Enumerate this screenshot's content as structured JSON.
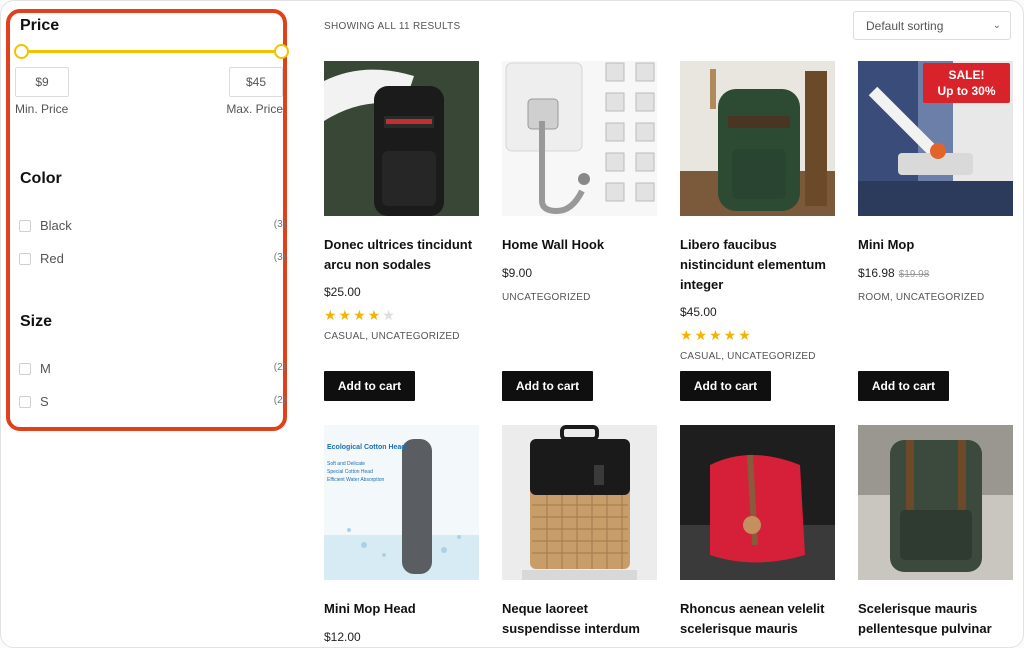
{
  "sidebar": {
    "price": {
      "title": "Price",
      "min_value": "$9",
      "max_value": "$45",
      "min_label": "Min. Price",
      "max_label": "Max. Price"
    },
    "color": {
      "title": "Color",
      "options": [
        {
          "label": "Black",
          "count": "(3)"
        },
        {
          "label": "Red",
          "count": "(3)"
        }
      ]
    },
    "size": {
      "title": "Size",
      "options": [
        {
          "label": "M",
          "count": "(2)"
        },
        {
          "label": "S",
          "count": "(2)"
        }
      ]
    }
  },
  "toolbar": {
    "results": "SHOWING ALL 11 RESULTS",
    "sort_selected": "Default sorting"
  },
  "products": [
    {
      "name": "Donec ultrices tincidunt arcu non sodales",
      "price": "$25.00",
      "rating": 4,
      "categories": "CASUAL, UNCATEGORIZED",
      "button": "Add to cart",
      "image": "black-backpack"
    },
    {
      "name": "Home Wall Hook",
      "price": "$9.00",
      "categories": "UNCATEGORIZED",
      "button": "Add to cart",
      "image": "wall-hook"
    },
    {
      "name": "Libero faucibus nistincidunt elementum integer",
      "price": "$45.00",
      "rating": 5,
      "categories": "CASUAL, UNCATEGORIZED",
      "button": "Add to cart",
      "image": "green-backpack"
    },
    {
      "name": "Mini Mop",
      "price": "$16.98",
      "old_price": "$19.98",
      "categories": "ROOM, UNCATEGORIZED",
      "button": "Add to cart",
      "image": "mini-mop",
      "badge_line1": "SALE!",
      "badge_line2": "Up to 30%"
    },
    {
      "name": "Mini Mop Head",
      "price": "$12.00",
      "image": "mop-head",
      "image_text": [
        "Ecological Cotton Head",
        "Soft and Delicate",
        "Special Cotton Head",
        "Efficient Water Absorption"
      ]
    },
    {
      "name": "Neque laoreet suspendisse interdum consectetur",
      "image": "woven-bag"
    },
    {
      "name": "Rhoncus aenean velelit scelerisque mauris",
      "image": "red-backpack"
    },
    {
      "name": "Scelerisque mauris pellentesque pulvinar",
      "image": "canvas-backpack"
    }
  ],
  "colors": {
    "accent_slider": "#f2c200",
    "sidebar_highlight": "#e0401a",
    "sale_badge": "#d8232a",
    "button_bg": "#0f0f0f",
    "star": "#f2b400"
  }
}
